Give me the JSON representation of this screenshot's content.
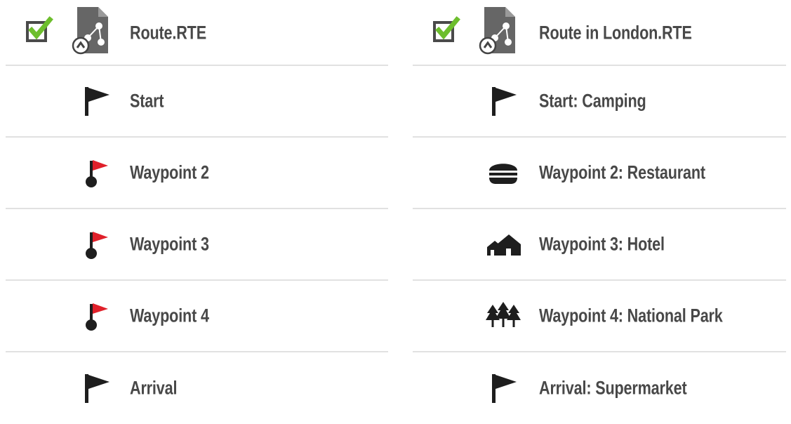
{
  "left_route": {
    "title": "Route.RTE",
    "checked": true,
    "items": [
      {
        "label": "Start",
        "icon": "black-flag-icon"
      },
      {
        "label": "Waypoint 2",
        "icon": "red-flag-pin-icon"
      },
      {
        "label": "Waypoint 3",
        "icon": "red-flag-pin-icon"
      },
      {
        "label": "Waypoint 4",
        "icon": "red-flag-pin-icon"
      },
      {
        "label": "Arrival",
        "icon": "black-flag-icon"
      }
    ]
  },
  "right_route": {
    "title": "Route in London.RTE",
    "checked": true,
    "items": [
      {
        "label": "Start: Camping",
        "icon": "black-flag-icon"
      },
      {
        "label": "Waypoint 2: Restaurant",
        "icon": "burger-icon"
      },
      {
        "label": "Waypoint 3: Hotel",
        "icon": "hotel-houses-icon"
      },
      {
        "label": "Waypoint 4: National Park",
        "icon": "trees-icon"
      },
      {
        "label": "Arrival: Supermarket",
        "icon": "black-flag-icon"
      }
    ]
  },
  "colors": {
    "check_green": "#6dbe2d",
    "flag_red": "#e0202a",
    "icon_dark": "#1e1e1e",
    "file_gray": "#666666",
    "divider": "#e1e1e1",
    "text": "#484848"
  }
}
